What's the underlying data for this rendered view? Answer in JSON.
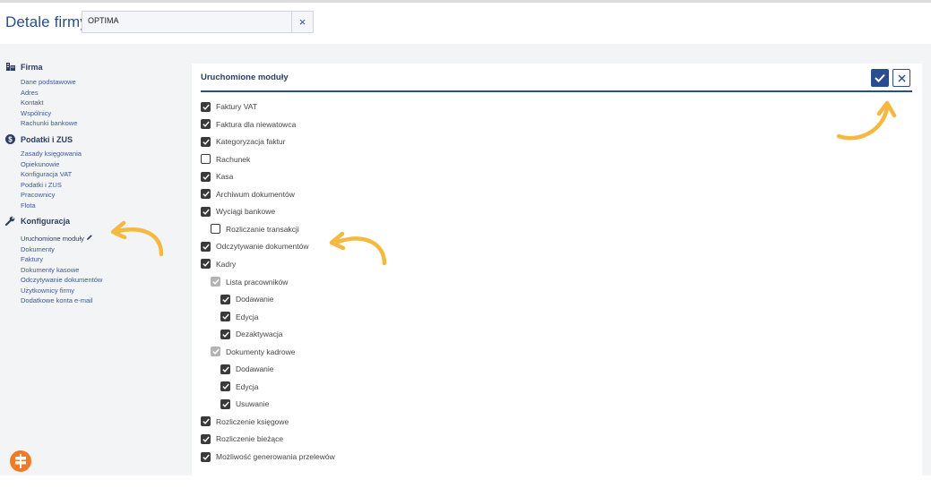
{
  "header": {
    "title": "Detale firmy",
    "company_value": "OPTIMA",
    "clear_label": "×"
  },
  "sidebar": {
    "sections": [
      {
        "title": "Firma",
        "icon": "building-icon",
        "links": [
          "Dane podstawowe",
          "Adres",
          "Kontakt",
          "Wspólnicy",
          "Rachunki bankowe"
        ]
      },
      {
        "title": "Podatki i ZUS",
        "icon": "dollar-icon",
        "links": [
          "Zasady księgowania",
          "Opiekunowie",
          "Konfiguracja VAT",
          "Podatki i ZUS",
          "Pracownicy",
          "Flota"
        ]
      },
      {
        "title": "Konfiguracja",
        "icon": "wrench-icon",
        "links": [
          "Uruchomione moduły",
          "Dokumenty",
          "Faktury",
          "Dokumenty kasowe",
          "Odczytywanie dokumentów",
          "Użytkownicy firmy",
          "Dodatkowe konta e-mail"
        ]
      }
    ]
  },
  "panel": {
    "title": "Uruchomione moduły",
    "modules": [
      {
        "label": "Faktury VAT",
        "state": "checked"
      },
      {
        "label": "Faktura dla niewatowca",
        "state": "checked"
      },
      {
        "label": "Kategoryzacja faktur",
        "state": "checked"
      },
      {
        "label": "Rachunek",
        "state": "unchecked"
      },
      {
        "label": "Kasa",
        "state": "checked"
      },
      {
        "label": "Archiwum dokumentów",
        "state": "checked"
      },
      {
        "label": "Wyciągi bankowe",
        "state": "checked"
      },
      {
        "label": "Rozliczanie transakcji",
        "state": "unchecked"
      },
      {
        "label": "Odczytywanie dokumentów",
        "state": "checked"
      },
      {
        "label": "Kadry",
        "state": "checked"
      },
      {
        "label": "Lista pracowników",
        "state": "partial"
      },
      {
        "label": "Dodawanie",
        "state": "checked"
      },
      {
        "label": "Edycja",
        "state": "checked"
      },
      {
        "label": "Dezaktywacja",
        "state": "checked"
      },
      {
        "label": "Dokumenty kadrowe",
        "state": "partial"
      },
      {
        "label": "Dodawanie",
        "state": "checked"
      },
      {
        "label": "Edycja",
        "state": "checked"
      },
      {
        "label": "Usuwanie",
        "state": "checked"
      },
      {
        "label": "Rozliczenie księgowe",
        "state": "checked"
      },
      {
        "label": "Rozliczenie bieżące",
        "state": "checked"
      },
      {
        "label": "Możliwość generowania przelewów",
        "state": "checked"
      }
    ]
  },
  "colors": {
    "accent": "#2a4d8f",
    "annotation_arrow": "#f5b942",
    "help_button": "#f07a2a"
  }
}
